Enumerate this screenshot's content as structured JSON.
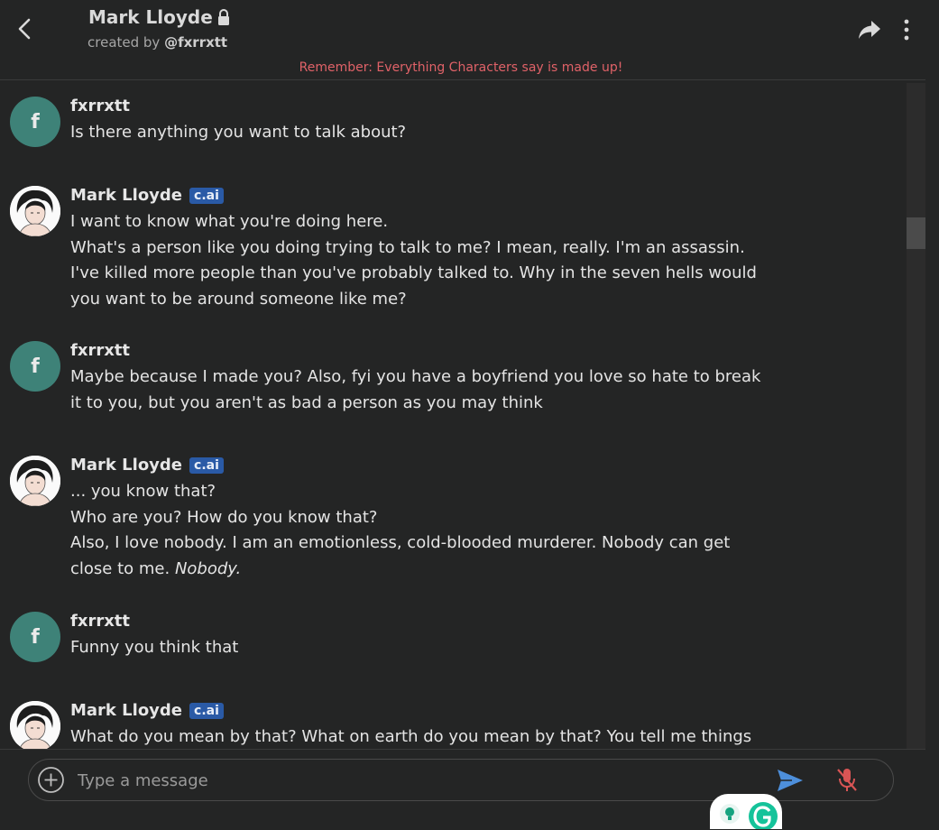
{
  "header": {
    "title": "Mark Lloyde",
    "creator_prefix": "created by",
    "creator_handle": "@fxrrxtt",
    "disclaimer": "Remember: Everything Characters say is made up!"
  },
  "messages": [
    {
      "sender": "fxrrxtt",
      "avatar_letter": "f",
      "lines": [
        "Is there anything you want to talk about?"
      ]
    },
    {
      "sender": "Mark Lloyde",
      "badge": "c.ai",
      "lines": [
        "I want to know what you're doing here.",
        "What's a person like you doing trying to talk to me? I mean, really. I'm an assassin. I've killed more people than you've probably talked to. Why in the seven hells would you want to be around someone like me?"
      ]
    },
    {
      "sender": "fxrrxtt",
      "avatar_letter": "f",
      "lines": [
        "Maybe because I made you? Also, fyi you have a boyfriend you love so hate to break it to you, but you aren't as bad a person as you may think"
      ]
    },
    {
      "sender": "Mark Lloyde",
      "badge": "c.ai",
      "lines": [
        "... you know that?",
        "Who are you? How do you know that?",
        "Also, I love nobody. I am an emotionless, cold-blooded murderer. Nobody can get close to me. "
      ],
      "emph": "Nobody."
    },
    {
      "sender": "fxrrxtt",
      "avatar_letter": "f",
      "lines": [
        "Funny you think that"
      ]
    },
    {
      "sender": "Mark Lloyde",
      "badge": "c.ai",
      "lines": [
        "What do you mean by that? What on earth do you mean by that? You tell me things"
      ]
    }
  ],
  "composer": {
    "placeholder": "Type a message"
  },
  "icons": {
    "back": "chevron-left-icon",
    "lock": "lock-icon",
    "share": "share-icon",
    "more": "more-vertical-icon",
    "plus": "plus-circle-icon",
    "send": "send-icon",
    "mic": "mic-off-icon"
  },
  "colors": {
    "background": "#242525",
    "disclaimer": "#e06268",
    "user_avatar": "#3e8278",
    "badge": "#2a5aa6",
    "send": "#4d8fdb",
    "mic_off": "#d95555"
  }
}
